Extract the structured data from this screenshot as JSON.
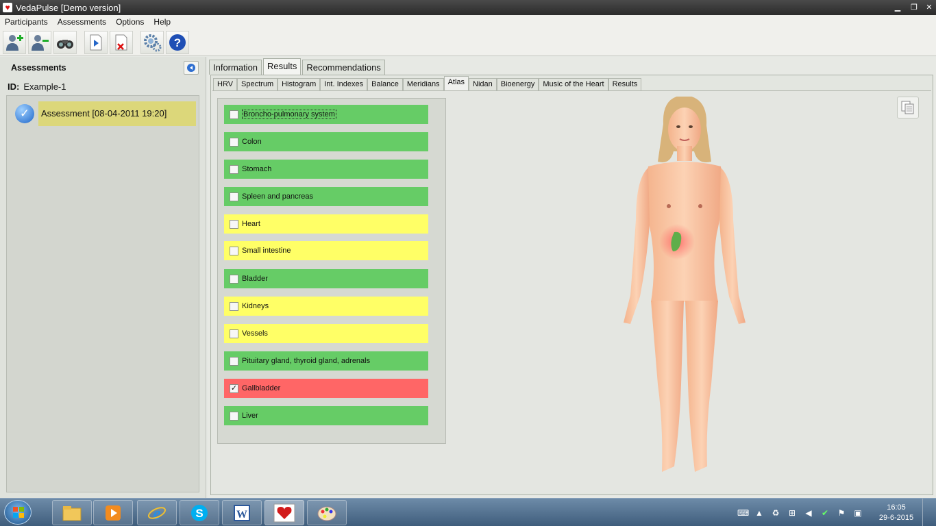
{
  "window": {
    "title": "VedaPulse [Demo version]",
    "minimize_glyph": "▁",
    "maximize_glyph": "❐",
    "close_glyph": "✕"
  },
  "menu": {
    "items": [
      "Participants",
      "Assessments",
      "Options",
      "Help"
    ]
  },
  "toolbar": {
    "buttons": [
      "add-participant-icon",
      "remove-participant-icon",
      "binoculars-icon",
      "play-document-icon",
      "delete-document-icon",
      "settings-gear-icon",
      "help-icon"
    ]
  },
  "left_panel": {
    "header": "Assessments",
    "id_label": "ID:",
    "id_value": "Example-1",
    "assessment_item": "Assessment [08-04-2011 19:20]",
    "highlight_color": "#dcd77a"
  },
  "main_tabs": {
    "items": [
      "Information",
      "Results",
      "Recommendations"
    ],
    "active": "Results"
  },
  "sub_tabs": {
    "items": [
      "HRV",
      "Spectrum",
      "Histogram",
      "Int. Indexes",
      "Balance",
      "Meridians",
      "Atlas",
      "Nidan",
      "Bioenergy",
      "Music of the Heart",
      "Results"
    ],
    "active": "Atlas"
  },
  "organs": [
    {
      "label": "Broncho-pulmonary system",
      "status": "green",
      "checked": false
    },
    {
      "label": "Colon",
      "status": "green",
      "checked": false
    },
    {
      "label": "Stomach",
      "status": "green",
      "checked": false
    },
    {
      "label": "Spleen and pancreas",
      "status": "green",
      "checked": false
    },
    {
      "label": "Heart",
      "status": "yellow",
      "checked": false
    },
    {
      "label": "Small intestine",
      "status": "yellow",
      "checked": false
    },
    {
      "label": "Bladder",
      "status": "green",
      "checked": false
    },
    {
      "label": "Kidneys",
      "status": "yellow",
      "checked": false
    },
    {
      "label": "Vessels",
      "status": "yellow",
      "checked": false
    },
    {
      "label": "Pituitary gland, thyroid gland, adrenals",
      "status": "green",
      "checked": false
    },
    {
      "label": "Gallbladder",
      "status": "red",
      "checked": true
    },
    {
      "label": "Liver",
      "status": "green",
      "checked": false
    }
  ],
  "status_colors": {
    "green": "#66cc66",
    "yellow": "#ffff66",
    "red": "#ff6666"
  },
  "taskbar": {
    "apps": [
      "explorer-icon",
      "media-player-icon",
      "internet-explorer-icon",
      "skype-icon",
      "word-icon",
      "vedapulse-icon",
      "paint-icon"
    ],
    "active_app": "vedapulse-icon",
    "time": "16:05",
    "date": "29-6-2015"
  }
}
